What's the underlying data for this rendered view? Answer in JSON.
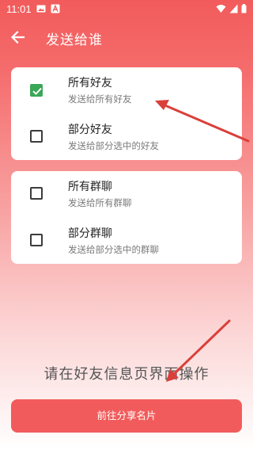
{
  "status_bar": {
    "time": "11:01"
  },
  "header": {
    "title": "发送给谁",
    "back_icon": "arrow-left-icon"
  },
  "groups": [
    {
      "options": [
        {
          "title": "所有好友",
          "subtitle": "发送给所有好友",
          "checked": true
        },
        {
          "title": "部分好友",
          "subtitle": "发送给部分选中的好友",
          "checked": false
        }
      ]
    },
    {
      "options": [
        {
          "title": "所有群聊",
          "subtitle": "发送给所有群聊",
          "checked": false
        },
        {
          "title": "部分群聊",
          "subtitle": "发送给部分选中的群聊",
          "checked": false
        }
      ]
    }
  ],
  "hint": "请在好友信息页界面操作",
  "share_button": "前往分享名片",
  "colors": {
    "accent": "#f25b5b",
    "checkbox_checked": "#3aa757",
    "annotation_arrow": "#d9403a"
  }
}
